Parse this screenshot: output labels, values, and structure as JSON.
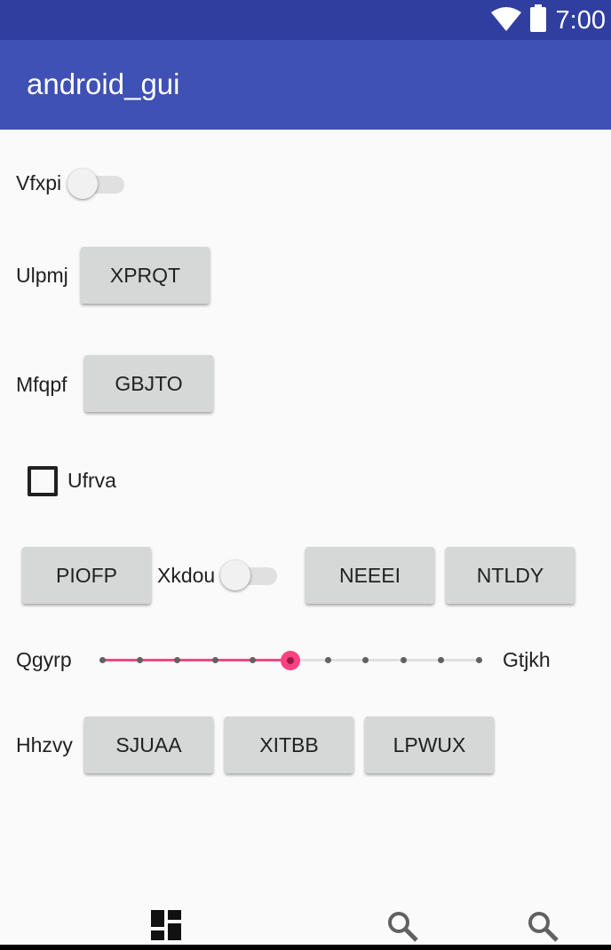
{
  "status_bar": {
    "time": "7:00",
    "wifi_icon": "wifi-icon",
    "battery_icon": "battery-icon"
  },
  "app_bar": {
    "title": "android_gui"
  },
  "row1": {
    "label": "Vfxpi",
    "switch_on": false
  },
  "row2": {
    "label": "Ulpmj",
    "button": "XPRQT"
  },
  "row3": {
    "label": "Mfqpf",
    "button": "GBJTO"
  },
  "row4": {
    "checkbox_label": "Ufrva",
    "checked": false
  },
  "row5": {
    "button1": "PIOFP",
    "switch_label": "Xkdou",
    "switch_on": false,
    "button2": "NEEEI",
    "button3": "NTLDY"
  },
  "row6": {
    "left_label": "Qgyrp",
    "right_label": "Gtjkh",
    "slider_value": 5,
    "slider_max": 10,
    "accent": "#ff4081"
  },
  "row7": {
    "label": "Hhzvy",
    "buttons": [
      "SJUAA",
      "XITBB",
      "LPWUX"
    ]
  },
  "bottom_nav": {
    "icons": [
      "dashboard-icon",
      "search-icon",
      "search-icon"
    ]
  },
  "colors": {
    "status_bar": "#303f9f",
    "app_bar": "#3f51b5",
    "background": "#fafafa",
    "button": "#d6d7d7"
  }
}
